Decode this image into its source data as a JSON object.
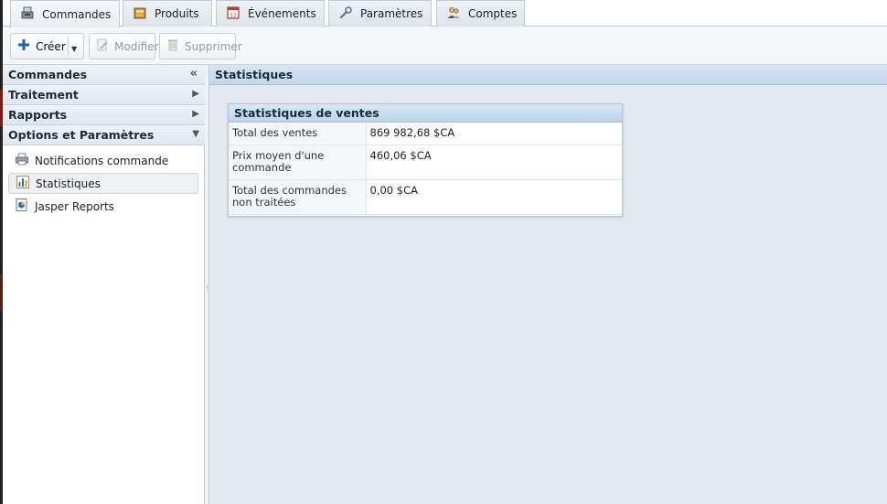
{
  "tabs": [
    {
      "label": "Commandes",
      "icon": "cash-register-icon",
      "active": true
    },
    {
      "label": "Produits",
      "icon": "product-box-icon",
      "active": false
    },
    {
      "label": "Événements",
      "icon": "calendar-icon",
      "active": false
    },
    {
      "label": "Paramètres",
      "icon": "wrench-icon",
      "active": false
    },
    {
      "label": "Comptes",
      "icon": "users-icon",
      "active": false
    }
  ],
  "toolbar": {
    "create_label": "Créer",
    "edit_label": "Modifier",
    "delete_label": "Supprimer"
  },
  "sidebar": {
    "sections": [
      {
        "label": "Commandes"
      },
      {
        "label": "Traitement"
      },
      {
        "label": "Rapports"
      },
      {
        "label": "Options et Paramètres"
      }
    ],
    "items": [
      {
        "label": "Notifications commande",
        "icon": "printer-icon"
      },
      {
        "label": "Statistiques",
        "icon": "chart-icon",
        "selected": true
      },
      {
        "label": "Jasper Reports",
        "icon": "report-icon"
      }
    ]
  },
  "main": {
    "title": "Statistiques",
    "panel": {
      "title": "Statistiques de ventes",
      "rows": [
        {
          "label": "Total des ventes",
          "value": "869 982,68 $CA"
        },
        {
          "label": "Prix moyen d'une commande",
          "value": "460,06 $CA"
        },
        {
          "label": "Total des commandes non traitées",
          "value": "0,00 $CA"
        }
      ]
    }
  },
  "colors": {
    "header_blue": "#c3d9ea",
    "background": "#e4e9ed",
    "create_plus": "#1f5fae"
  }
}
